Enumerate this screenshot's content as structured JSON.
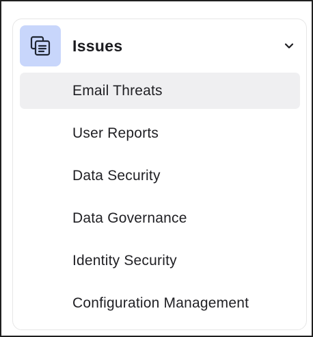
{
  "section": {
    "title": "Issues",
    "icon": "issues-icon",
    "expanded": true,
    "accent_color": "#c8d6fb",
    "items": [
      {
        "label": "Email Threats",
        "active": true
      },
      {
        "label": "User Reports",
        "active": false
      },
      {
        "label": "Data Security",
        "active": false
      },
      {
        "label": "Data Governance",
        "active": false
      },
      {
        "label": "Identity Security",
        "active": false
      },
      {
        "label": "Configuration Management",
        "active": false
      }
    ]
  }
}
